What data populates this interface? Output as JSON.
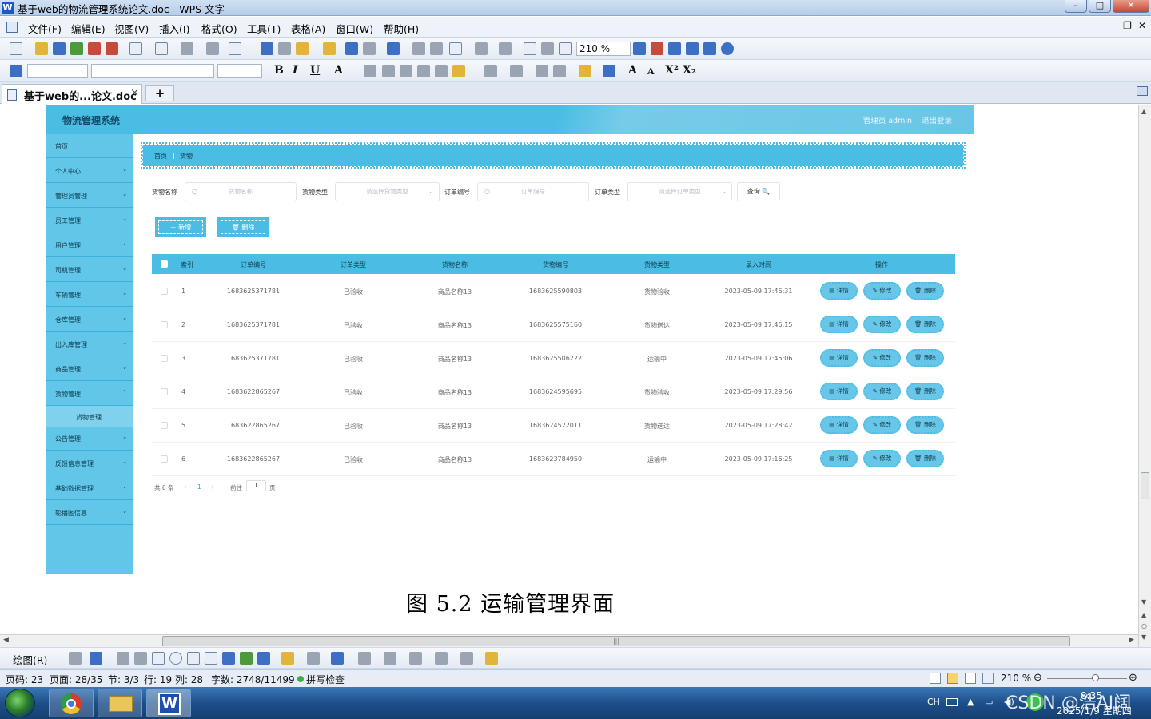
{
  "window": {
    "title": "基于web的物流管理系统论文.doc - WPS 文字"
  },
  "menu": [
    "文件(F)",
    "编辑(E)",
    "视图(V)",
    "插入(I)",
    "格式(O)",
    "工具(T)",
    "表格(A)",
    "窗口(W)",
    "帮助(H)"
  ],
  "toolbar": {
    "zoom": "210 %"
  },
  "tab": {
    "label": "基于web的...论文.doc",
    "close": "×",
    "add": "+"
  },
  "web": {
    "brand": "物流管理系统",
    "admin": "管理员 admin",
    "logout": "退出登录",
    "sidebar": [
      {
        "label": "首页",
        "arrow": ""
      },
      {
        "label": "个人中心",
        "arrow": "⌄"
      },
      {
        "label": "管理员管理",
        "arrow": "⌄"
      },
      {
        "label": "员工管理",
        "arrow": "⌄"
      },
      {
        "label": "用户管理",
        "arrow": "⌄"
      },
      {
        "label": "司机管理",
        "arrow": "⌄"
      },
      {
        "label": "车辆管理",
        "arrow": "⌄"
      },
      {
        "label": "仓库管理",
        "arrow": "⌄"
      },
      {
        "label": "出入库管理",
        "arrow": "⌄"
      },
      {
        "label": "商品管理",
        "arrow": "⌄"
      },
      {
        "label": "货物管理",
        "arrow": "⌃"
      }
    ],
    "sidebar_sub": "货物管理",
    "sidebar_after": [
      {
        "label": "公告管理",
        "arrow": "⌄"
      },
      {
        "label": "反馈信息管理",
        "arrow": "⌄"
      },
      {
        "label": "基础数据管理",
        "arrow": "⌄"
      },
      {
        "label": "轮播图信息",
        "arrow": "⌄"
      }
    ],
    "breadcrumb": {
      "home": "首页",
      "sep": "|",
      "current": "货物"
    },
    "filters": {
      "goods_name_label": "货物名称",
      "goods_name_ph": "货物名称",
      "goods_type_label": "货物类型",
      "goods_type_ph": "请选择货物类型",
      "order_no_label": "订单编号",
      "order_no_ph": "订单编号",
      "order_type_label": "订单类型",
      "order_type_ph": "请选择订单类型",
      "query": "查询 🔍"
    },
    "actions": {
      "add": "＋ 新增",
      "delete": "🗑 删除"
    },
    "columns": [
      "索引",
      "订单编号",
      "订单类型",
      "货物名称",
      "货物编号",
      "货物类型",
      "录入时间",
      "操作"
    ],
    "rows": [
      {
        "idx": "1",
        "order_no": "1683625371781",
        "order_type": "已验收",
        "goods_name": "商品名称13",
        "goods_no": "1683625590803",
        "goods_type": "货物验收",
        "time": "2023-05-09 17:46:31"
      },
      {
        "idx": "2",
        "order_no": "1683625371781",
        "order_type": "已验收",
        "goods_name": "商品名称13",
        "goods_no": "1683625575160",
        "goods_type": "货物送达",
        "time": "2023-05-09 17:46:15"
      },
      {
        "idx": "3",
        "order_no": "1683625371781",
        "order_type": "已验收",
        "goods_name": "商品名称13",
        "goods_no": "1683625506222",
        "goods_type": "运输中",
        "time": "2023-05-09 17:45:06"
      },
      {
        "idx": "4",
        "order_no": "1683622865267",
        "order_type": "已验收",
        "goods_name": "商品名称13",
        "goods_no": "1683624595695",
        "goods_type": "货物验收",
        "time": "2023-05-09 17:29:56"
      },
      {
        "idx": "5",
        "order_no": "1683622865267",
        "order_type": "已验收",
        "goods_name": "商品名称13",
        "goods_no": "1683624522011",
        "goods_type": "货物送达",
        "time": "2023-05-09 17:28:42"
      },
      {
        "idx": "6",
        "order_no": "1683622865267",
        "order_type": "已验收",
        "goods_name": "商品名称13",
        "goods_no": "1683623784950",
        "goods_type": "运输中",
        "time": "2023-05-09 17:16:25"
      }
    ],
    "row_ops": {
      "detail": "▤ 详情",
      "edit": "✎ 修改",
      "del": "🗑 删除"
    },
    "pager": {
      "total": "共 6 条",
      "prev": "‹",
      "page": "1",
      "next": "›",
      "goto": "前往",
      "input": "1",
      "unit": "页"
    }
  },
  "caption": "图 5.2  运输管理界面",
  "drawbar": {
    "label": "绘图(R)"
  },
  "status": {
    "page_code": "页码: 23",
    "page": "页面: 28/35",
    "section": "节: 3/3",
    "row_col": "行: 19  列: 28",
    "words": "字数: 2748/11499",
    "spell": "拼写检查",
    "zoom": "210 %"
  },
  "tray": {
    "lang": "CH",
    "time": "8:35",
    "date": "2025/1/9 星期四",
    "watermark": "CSDN @浩AI阔"
  }
}
